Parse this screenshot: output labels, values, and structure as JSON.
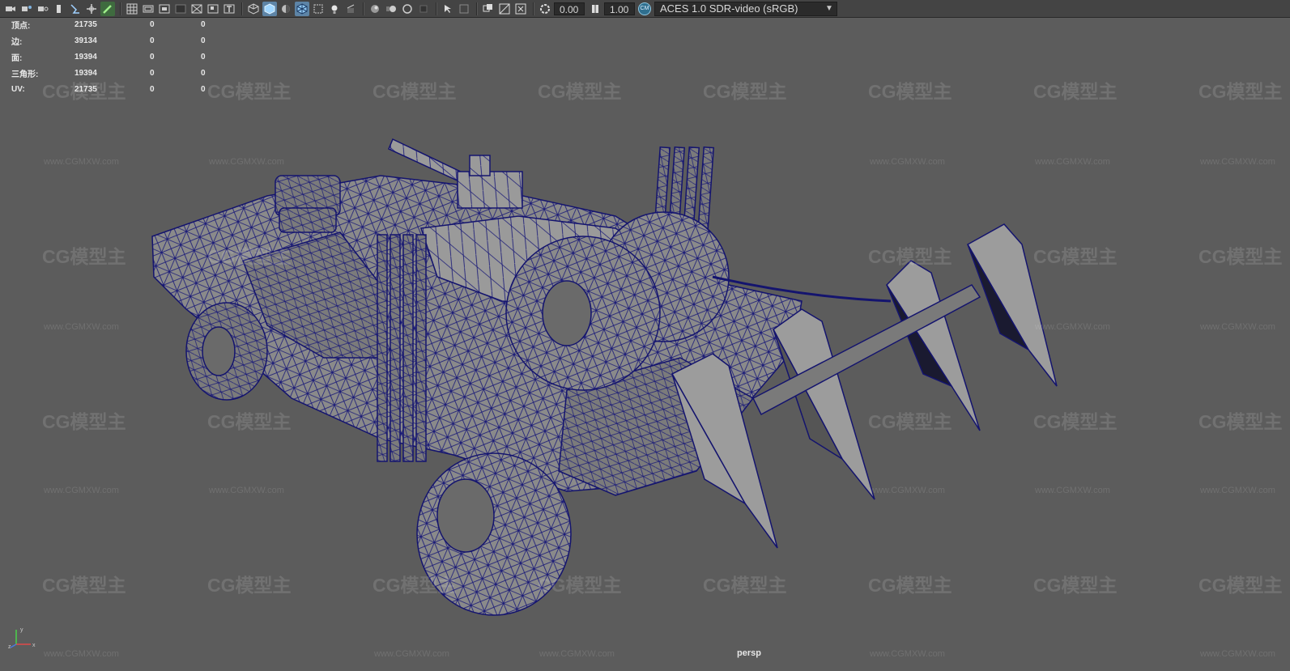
{
  "toolbar": {
    "icons": [
      "camera-icon",
      "camera-attr-icon",
      "bookmark-icon",
      "image-plane-icon",
      "grid-snap-icon",
      "pan-icon",
      "grease-pencil-icon",
      "grid-icon",
      "film-gate-icon",
      "resolution-gate-icon",
      "gate-mask-icon",
      "field-chart-icon",
      "safe-action-icon",
      "safe-title-icon",
      "wireframe-icon",
      "smooth-shade-icon",
      "default-material-icon",
      "wireframe-on-shaded-icon",
      "xray-icon",
      "use-lights-icon",
      "shadows-icon",
      "ambient-occlusion-icon",
      "motion-blur-icon",
      "anti-alias-icon",
      "depth-of-field-icon",
      "isolate-select-icon",
      "xray-joints-icon",
      "xray-active-icon",
      "exposure-icon",
      "gamma-icon"
    ],
    "exposure_value": "0.00",
    "gamma_value": "1.00",
    "color_space": "ACES 1.0 SDR-video (sRGB)"
  },
  "hud": {
    "rows": [
      {
        "label": "顶点:",
        "c1": "21735",
        "c2": "0",
        "c3": "0"
      },
      {
        "label": "边:",
        "c1": "39134",
        "c2": "0",
        "c3": "0"
      },
      {
        "label": "面:",
        "c1": "19394",
        "c2": "0",
        "c3": "0"
      },
      {
        "label": "三角形:",
        "c1": "19394",
        "c2": "0",
        "c3": "0"
      },
      {
        "label": "UV:",
        "c1": "21735",
        "c2": "0",
        "c3": "0"
      }
    ]
  },
  "viewport": {
    "camera": "persp",
    "watermark_logo": "CG模型主",
    "watermark_url": "www.CGMXW.com",
    "axis_labels": {
      "y": "y",
      "x": "x",
      "z": "z"
    }
  },
  "colors": {
    "background": "#5c5c5c",
    "wire": "#14146e",
    "mesh": "#8a8a8a",
    "toolbar": "#444444",
    "accent": "#5d84a6"
  }
}
